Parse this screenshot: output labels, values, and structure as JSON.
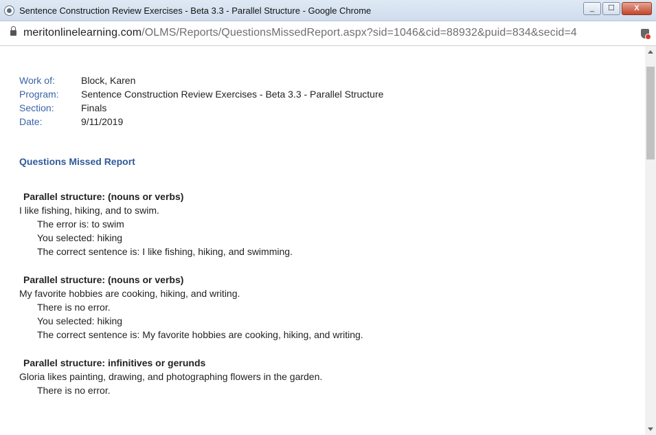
{
  "window": {
    "title": "Sentence Construction Review Exercises - Beta 3.3 - Parallel Structure - Google Chrome",
    "minimize_label": "_",
    "maximize_label": "☐",
    "close_label": "X"
  },
  "address": {
    "domain": "meritonlinelearning.com",
    "path": "/OLMS/Reports/QuestionsMissedReport.aspx?sid=1046&cid=88932&puid=834&secid=4"
  },
  "meta": {
    "work_of_label": "Work of:",
    "work_of": "Block, Karen",
    "program_label": "Program:",
    "program": "Sentence Construction Review Exercises - Beta 3.3 - Parallel Structure",
    "section_label": "Section:",
    "section": "Finals",
    "date_label": "Date:",
    "date": "9/11/2019"
  },
  "report_title": "Questions Missed Report",
  "questions": [
    {
      "heading": "Parallel structure: (nouns or verbs)",
      "sentence": "I like fishing, hiking, and to swim.",
      "error": "The error is:  to swim",
      "selected": "You selected:  hiking",
      "correct": "The correct sentence is: I like fishing, hiking, and swimming."
    },
    {
      "heading": "Parallel structure: (nouns or verbs)",
      "sentence": "My favorite hobbies are cooking, hiking, and writing.",
      "error": "There is no error.",
      "selected": "You selected:  hiking",
      "correct": "The correct sentence is: My favorite hobbies are cooking, hiking, and writing."
    },
    {
      "heading": "Parallel structure: infinitives or gerunds",
      "sentence": "Gloria likes painting, drawing, and photographing flowers in the garden.",
      "error": "There is no error."
    }
  ]
}
